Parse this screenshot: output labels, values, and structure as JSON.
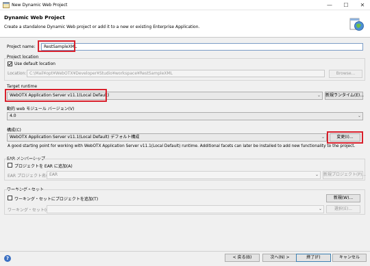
{
  "window": {
    "title": "New Dynamic Web Project",
    "minimize": "—",
    "maximize": "☐",
    "close": "✕"
  },
  "banner": {
    "title": "Dynamic Web Project",
    "description": "Create a standalone Dynamic Web project or add it to a new or existing Enterprise Application."
  },
  "project_name": {
    "label": "Project name:",
    "value": "RestSampleXML"
  },
  "project_location": {
    "group_label": "Project location",
    "use_default_label": "Use default location",
    "use_default_checked": true,
    "location_label": "Location:",
    "location_value": "C:\\Mail¥opt¥WebOTX¥Developer¥Studio¥workspace¥RestSampleXML",
    "browse_label": "Browse..."
  },
  "target_runtime": {
    "label": "Target runtime",
    "value": "WebOTX Application Server v11.1(Local Default)",
    "new_runtime_label": "新規ランタイム(E)..."
  },
  "module_version": {
    "label": "動的 web モジュール バージョン(V)",
    "value": "4.0"
  },
  "configuration": {
    "label": "構成(C)",
    "value": "WebOTX Application Server v11.1(Local Default) デフォルト構成",
    "modify_label": "変更(I)...",
    "hint": "A good starting point for working with WebOTX Application Server v11.1(Local Default) runtime. Additional facets can later be installed to add new functionality to the project."
  },
  "ear": {
    "group_label": "EAR メンバーシップ",
    "add_label": "プロジェクトを EAR に追加(A)",
    "add_checked": false,
    "name_label": "EAR プロジェクト名(E):",
    "name_value": "EAR",
    "new_project_label": "新規プロジェクト(P)..."
  },
  "working_set": {
    "group_label": "ワーキング・セット",
    "add_label": "ワーキング・セットにプロジェクトを追加(T)",
    "add_checked": false,
    "new_label": "新規(W)...",
    "sets_label": "ワーキング・セット(O):",
    "sets_value": "",
    "select_label": "選択(E)..."
  },
  "footer": {
    "help": "?",
    "back": "< 戻る(B)",
    "next": "次へ(N) >",
    "finish": "終了(F)",
    "cancel": "キャンセル"
  },
  "colors": {
    "highlight": "#d9202c",
    "help_button": "#3a6fc2"
  }
}
